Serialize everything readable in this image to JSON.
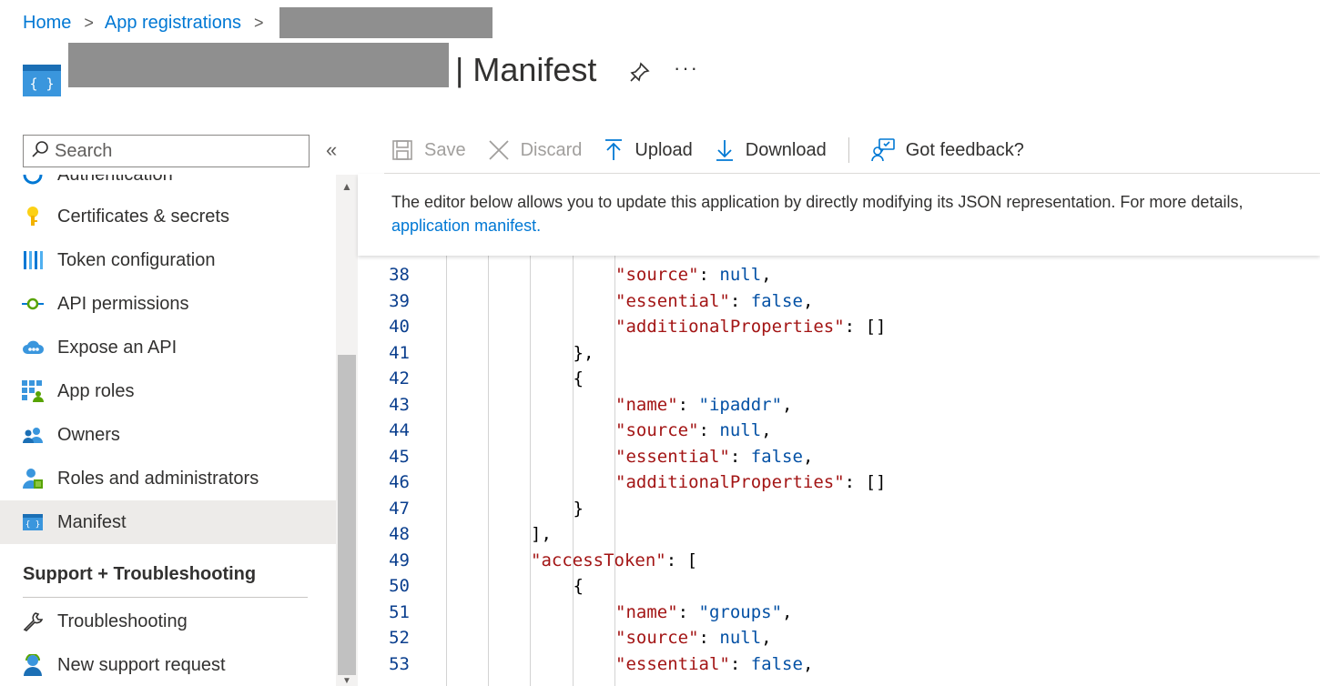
{
  "breadcrumb": {
    "home": "Home",
    "app_registrations": "App registrations",
    "separator": ">"
  },
  "title": {
    "suffix": "| Manifest",
    "more": "···"
  },
  "sidebar": {
    "search_placeholder": "Search",
    "collapse": "«",
    "partial_item": "Authentication",
    "items": [
      {
        "label": "Certificates & secrets",
        "icon": "key-icon"
      },
      {
        "label": "Token configuration",
        "icon": "token-bars-icon"
      },
      {
        "label": "API permissions",
        "icon": "api-permissions-icon"
      },
      {
        "label": "Expose an API",
        "icon": "cloud-api-icon"
      },
      {
        "label": "App roles",
        "icon": "app-roles-grid-icon"
      },
      {
        "label": "Owners",
        "icon": "owners-icon"
      },
      {
        "label": "Roles and administrators",
        "icon": "roles-admin-icon"
      },
      {
        "label": "Manifest",
        "icon": "manifest-icon",
        "selected": true
      }
    ],
    "support_section": "Support + Troubleshooting",
    "support_items": [
      {
        "label": "Troubleshooting",
        "icon": "wrench-icon"
      },
      {
        "label": "New support request",
        "icon": "support-person-icon"
      }
    ]
  },
  "toolbar": {
    "save": "Save",
    "discard": "Discard",
    "upload": "Upload",
    "download": "Download",
    "feedback": "Got feedback?"
  },
  "info": {
    "text": "The editor below allows you to update this application by directly modifying its JSON representation. For more details,",
    "link": "application manifest."
  },
  "editor": {
    "lines": [
      {
        "n": "38",
        "indent": 4,
        "key": "\"source\"",
        "value": "null",
        "vtype": "kw",
        "trail": ","
      },
      {
        "n": "39",
        "indent": 4,
        "key": "\"essential\"",
        "value": "false",
        "vtype": "kw",
        "trail": ","
      },
      {
        "n": "40",
        "indent": 4,
        "key": "\"additionalProperties\"",
        "value": "[]",
        "vtype": "p",
        "trail": ""
      },
      {
        "n": "41",
        "indent": 3,
        "raw": "},"
      },
      {
        "n": "42",
        "indent": 3,
        "raw": "{"
      },
      {
        "n": "43",
        "indent": 4,
        "key": "\"name\"",
        "value": "\"ipaddr\"",
        "vtype": "s",
        "trail": ","
      },
      {
        "n": "44",
        "indent": 4,
        "key": "\"source\"",
        "value": "null",
        "vtype": "kw",
        "trail": ","
      },
      {
        "n": "45",
        "indent": 4,
        "key": "\"essential\"",
        "value": "false",
        "vtype": "kw",
        "trail": ","
      },
      {
        "n": "46",
        "indent": 4,
        "key": "\"additionalProperties\"",
        "value": "[]",
        "vtype": "p",
        "trail": ""
      },
      {
        "n": "47",
        "indent": 3,
        "raw": "}"
      },
      {
        "n": "48",
        "indent": 2,
        "raw": "],"
      },
      {
        "n": "49",
        "indent": 2,
        "key": "\"accessToken\"",
        "value": "[",
        "vtype": "p",
        "trail": ""
      },
      {
        "n": "50",
        "indent": 3,
        "raw": "{"
      },
      {
        "n": "51",
        "indent": 4,
        "key": "\"name\"",
        "value": "\"groups\"",
        "vtype": "s",
        "trail": ","
      },
      {
        "n": "52",
        "indent": 4,
        "key": "\"source\"",
        "value": "null",
        "vtype": "kw",
        "trail": ","
      },
      {
        "n": "53",
        "indent": 4,
        "key": "\"essential\"",
        "value": "false",
        "vtype": "kw",
        "trail": ","
      }
    ]
  },
  "colors": {
    "accent": "#0078d4",
    "json_key": "#a31515",
    "json_value": "#0451a5",
    "line_number": "#0b3f8e"
  }
}
